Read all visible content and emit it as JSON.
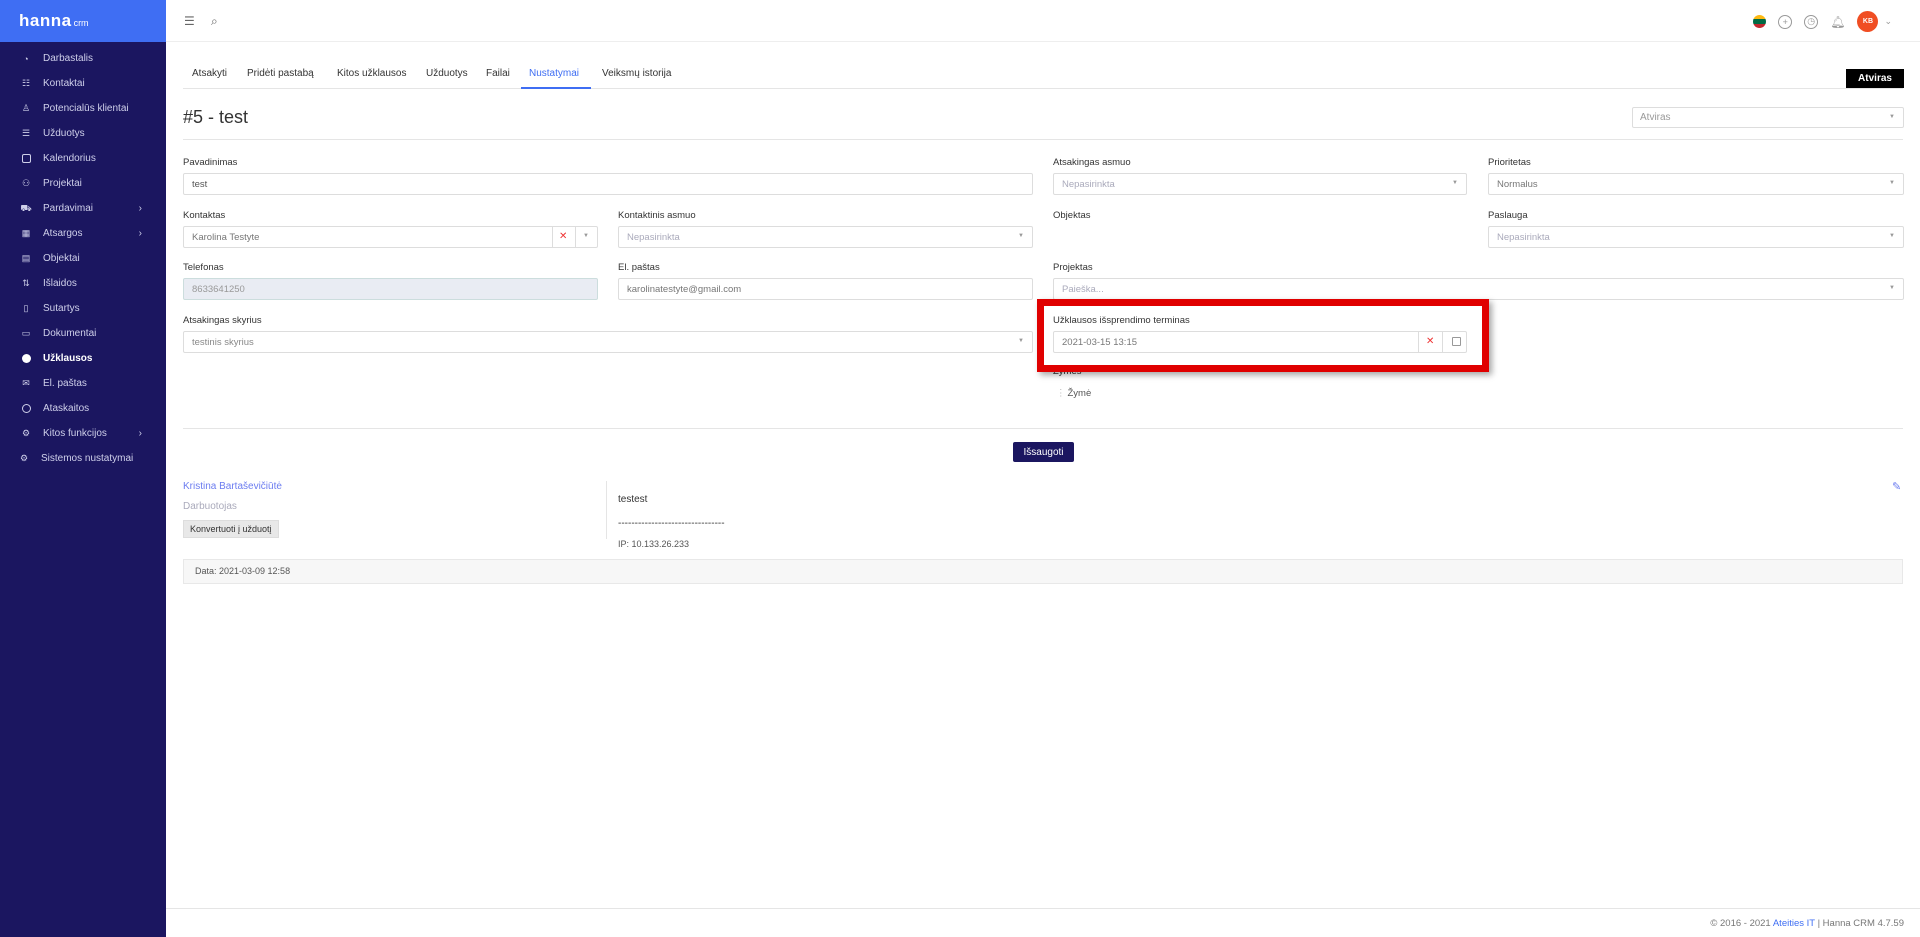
{
  "brand": {
    "name": "hanna",
    "sub": "crm"
  },
  "sidebar": {
    "items": [
      {
        "label": "Darbastalis",
        "icon": "dashboard-icon"
      },
      {
        "label": "Kontaktai",
        "icon": "contacts-icon"
      },
      {
        "label": "Potencialūs klientai",
        "icon": "leads-icon"
      },
      {
        "label": "Užduotys",
        "icon": "tasks-icon"
      },
      {
        "label": "Kalendorius",
        "icon": "calendar-icon"
      },
      {
        "label": "Projektai",
        "icon": "projects-icon"
      },
      {
        "label": "Pardavimai",
        "icon": "sales-icon"
      },
      {
        "label": "Atsargos",
        "icon": "inventory-icon"
      },
      {
        "label": "Objektai",
        "icon": "objects-icon"
      },
      {
        "label": "Išlaidos",
        "icon": "expenses-icon"
      },
      {
        "label": "Sutartys",
        "icon": "contracts-icon"
      },
      {
        "label": "Dokumentai",
        "icon": "documents-icon"
      },
      {
        "label": "Užklausos",
        "icon": "inquiries-icon"
      },
      {
        "label": "El. paštas",
        "icon": "email-icon"
      },
      {
        "label": "Ataskaitos",
        "icon": "reports-icon"
      },
      {
        "label": "Kitos funkcijos",
        "icon": "other-functions-icon"
      },
      {
        "label": "Sistemos nustatymai",
        "icon": "settings-icon"
      }
    ],
    "active": "Užklausos"
  },
  "topbar": {
    "avatar_initials": "KB"
  },
  "tabs": [
    {
      "label": "Atsakyti"
    },
    {
      "label": "Pridėti pastabą"
    },
    {
      "label": "Kitos užklausos"
    },
    {
      "label": "Užduotys"
    },
    {
      "label": "Failai"
    },
    {
      "label": "Nustatymai"
    },
    {
      "label": "Veiksmų istorija"
    }
  ],
  "status_button": "Atviras",
  "title": "#5 - test",
  "status_select": "Atviras",
  "form": {
    "name_label": "Pavadinimas",
    "name_value": "test",
    "responsible_label": "Atsakingas asmuo",
    "responsible_value": "Nepasirinkta",
    "priority_label": "Prioritetas",
    "priority_value": "Normalus",
    "contact_label": "Kontaktas",
    "contact_value": "Karolina Testyte",
    "contact_person_label": "Kontaktinis asmuo",
    "contact_person_value": "Nepasirinkta",
    "object_label": "Objektas",
    "service_label": "Paslauga",
    "service_value": "Nepasirinkta",
    "phone_label": "Telefonas",
    "phone_value": "8633641250",
    "email_label": "El. paštas",
    "email_value": "karolinatestyte@gmail.com",
    "project_label": "Projektas",
    "project_value": "Paieška...",
    "department_label": "Atsakingas skyrius",
    "department_value": "testinis skyrius",
    "deadline_label": "Užklausos išsprendimo terminas",
    "deadline_value": "2021-03-15 13:15",
    "tags_label": "Žymės",
    "tags_value": "Žymė"
  },
  "save_button": "Išsaugoti",
  "note": {
    "author": "Kristina Bartaševičiūtė",
    "role": "Darbuotojas",
    "convert_button": "Konvertuoti į užduotį",
    "body": "testest",
    "divider": "--------------------------------",
    "ip": "IP: 10.133.26.233",
    "date": "Data: 2021-03-09 12:58"
  },
  "footer": {
    "prefix": "© 2016 - 2021",
    "link": "Ateities IT",
    "suffix": "| Hanna CRM 4.7.59"
  },
  "colors": {
    "sidebar": "#1b1660",
    "brand": "#3f6ef3",
    "highlight": "#e00000"
  }
}
